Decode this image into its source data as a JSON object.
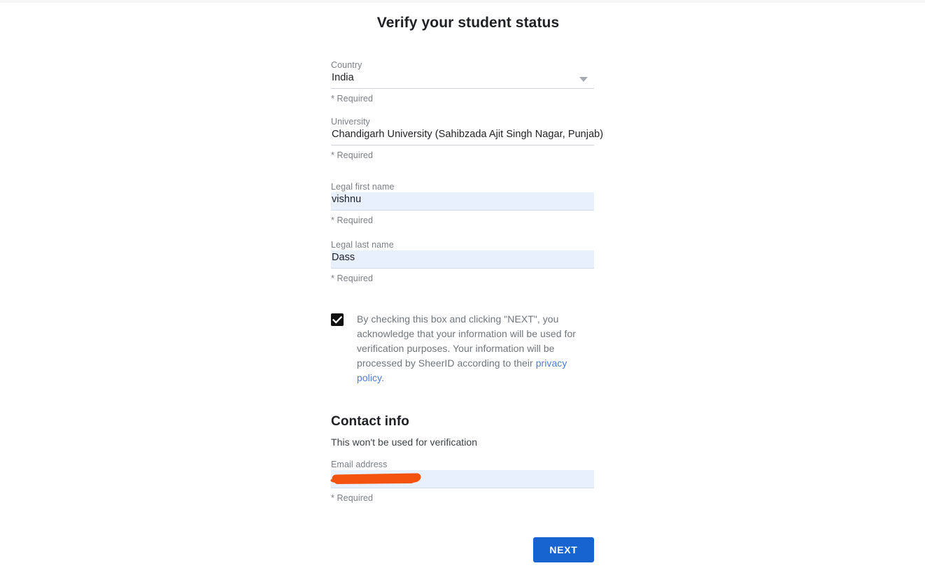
{
  "page": {
    "title": "Verify your student status"
  },
  "form": {
    "fields": [
      {
        "label": "Country",
        "value": "India",
        "required_note": "* Required",
        "type": "select",
        "icon": "chevron-down-icon",
        "autofilled": false
      },
      {
        "label": "University",
        "value": "Chandigarh University (Sahibzada Ajit Singh Nagar, Punjab)",
        "required_note": "* Required",
        "type": "text",
        "autofilled": false
      },
      {
        "label": "Legal first name",
        "value": "vishnu",
        "required_note": "* Required",
        "type": "text",
        "autofilled": true
      },
      {
        "label": "Legal last name",
        "value": "Dass",
        "required_note": "* Required",
        "type": "text",
        "autofilled": true
      }
    ]
  },
  "consent": {
    "checked": true,
    "text_before_link": "By checking this box and clicking \"NEXT\", you acknowledge that your information will be used for verification purposes. Your information will be processed by SheerID according to their ",
    "link_text": "privacy policy",
    "text_after_link": "."
  },
  "contact": {
    "heading": "Contact info",
    "subtitle": "This won't be used for verification",
    "email": {
      "label": "Email address",
      "value": "",
      "required_note": "* Required",
      "redacted": true,
      "autofilled": true
    }
  },
  "actions": {
    "next_label": "NEXT"
  },
  "colors": {
    "primary_button": "#1764d0",
    "link": "#4c7fd1",
    "autofill_background": "#e8f0fe",
    "redaction_marker": "#f4530f",
    "label_text": "#7b7f85",
    "value_text": "#202124"
  }
}
